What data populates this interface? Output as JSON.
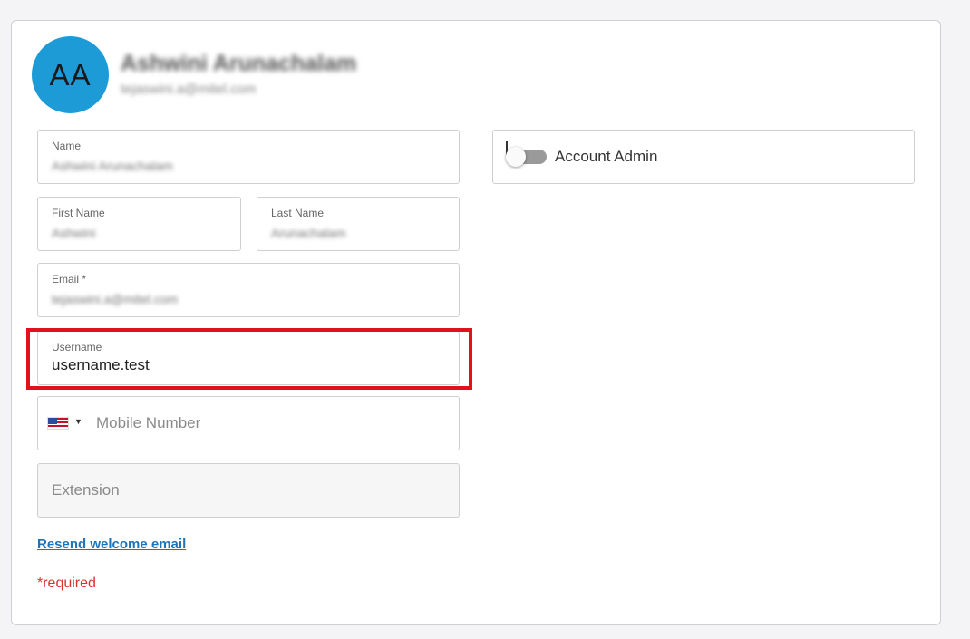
{
  "profile": {
    "initials": "AA",
    "name": "Ashwini Arunachalam",
    "email": "tejaswini.a@mitel.com",
    "avatar_color": "#1d9bd7"
  },
  "form": {
    "name": {
      "label": "Name",
      "value": "Ashwini Arunachalam"
    },
    "first_name": {
      "label": "First Name",
      "value": "Ashwini"
    },
    "last_name": {
      "label": "Last Name",
      "value": "Arunachalam"
    },
    "email": {
      "label": "Email *",
      "value": "tejaswini.a@mitel.com"
    },
    "username": {
      "label": "Username",
      "value": "username.test"
    },
    "mobile": {
      "country_icon": "us-flag-icon",
      "placeholder": "Mobile Number"
    },
    "extension": {
      "placeholder": "Extension"
    }
  },
  "account_admin": {
    "label": "Account Admin",
    "enabled": false
  },
  "links": {
    "resend_welcome": "Resend welcome email"
  },
  "required_note": "*required",
  "colors": {
    "highlight": "#e0131c",
    "link": "#1f73b7",
    "required": "#d9332a"
  }
}
